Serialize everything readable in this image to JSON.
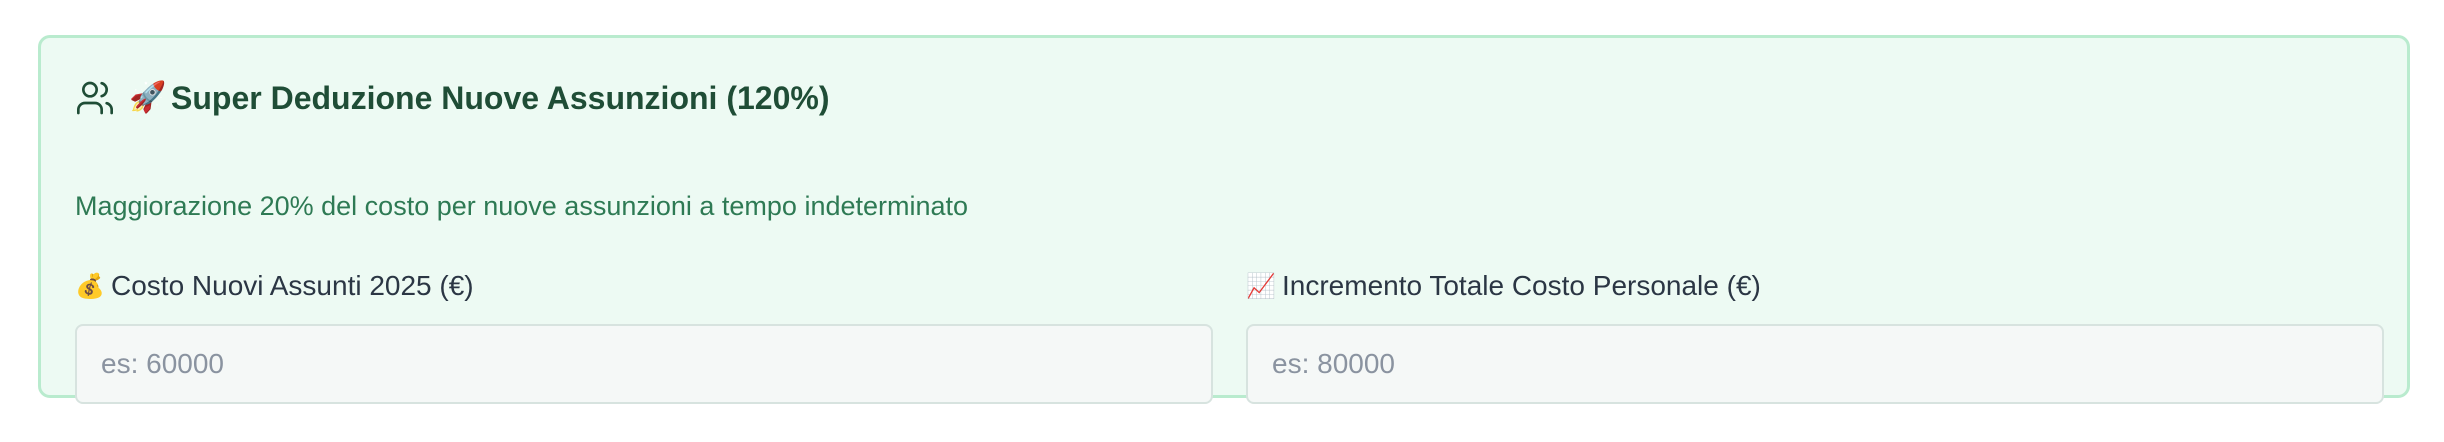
{
  "section": {
    "icon": "users-icon",
    "title_emoji": "🚀",
    "title": "Super Deduzione Nuove Assunzioni (120%)",
    "subtitle": "Maggiorazione 20% del costo per nuove assunzioni a tempo indeterminato"
  },
  "fields": [
    {
      "emoji": "💰",
      "label": "Costo Nuovi Assunti 2025 (€)",
      "value": "",
      "placeholder": "es: 60000"
    },
    {
      "emoji": "📈",
      "label": "Incremento Totale Costo Personale (€)",
      "value": "",
      "placeholder": "es: 80000"
    }
  ],
  "colors": {
    "card_background": "#edfaf3",
    "card_border": "#b9ebce",
    "title": "#1f4d36",
    "subtitle": "#2e7a54"
  }
}
